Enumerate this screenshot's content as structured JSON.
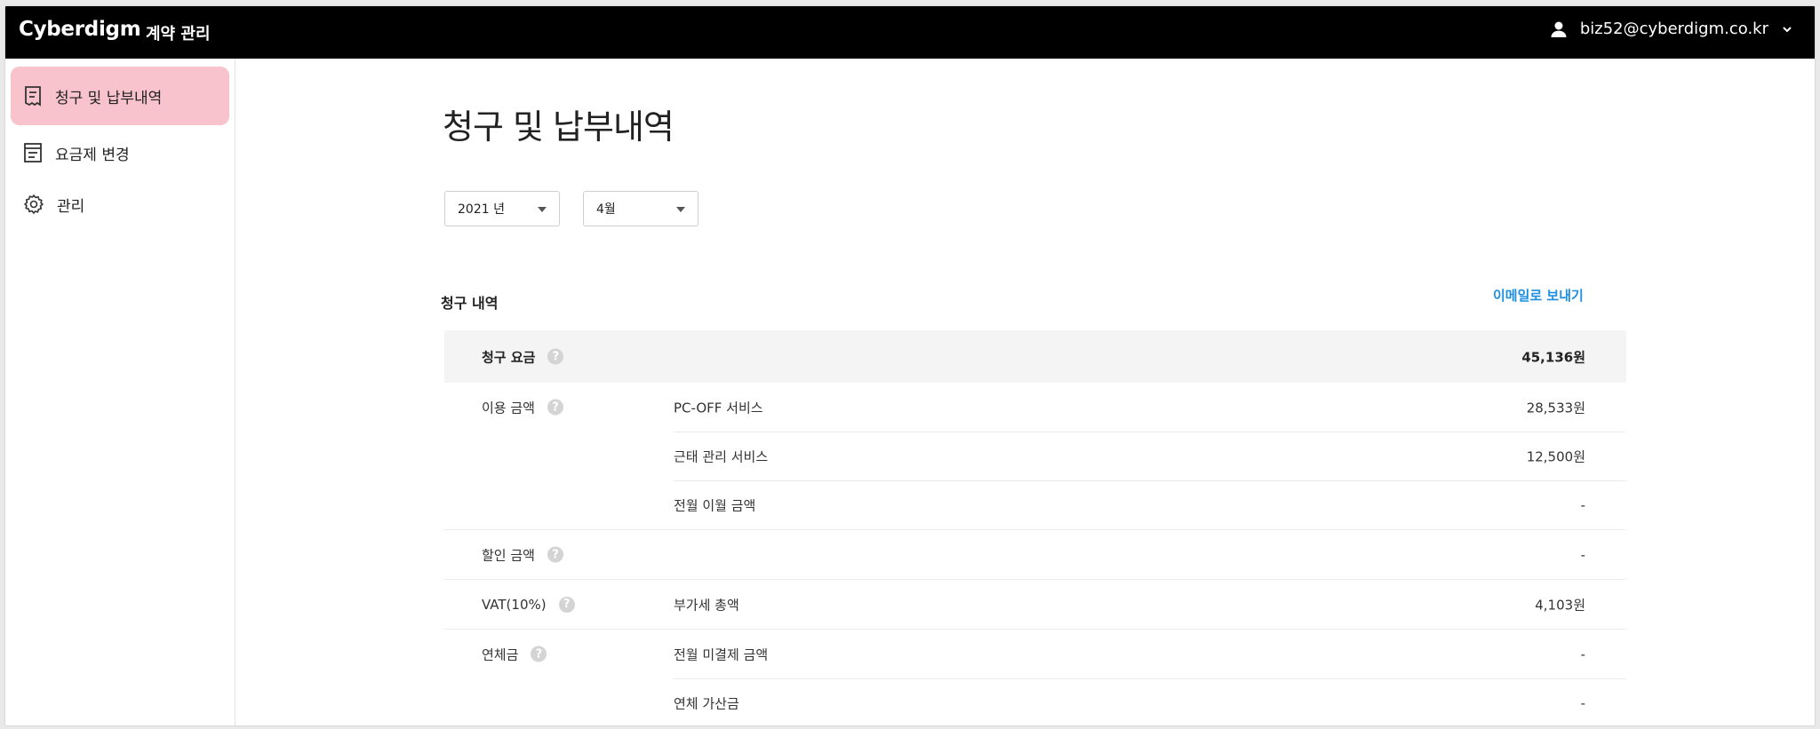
{
  "header": {
    "brand": "Cyberdigm",
    "app_name": "계약 관리",
    "user_email": "biz52@cyberdigm.co.kr",
    "user_icon": "user-icon",
    "menu_icon": "chevron-down-icon"
  },
  "sidebar": {
    "items": [
      {
        "label": "청구 및 납부내역",
        "icon": "receipt-icon",
        "active": true
      },
      {
        "label": "요금제 변경",
        "icon": "list-icon",
        "active": false
      },
      {
        "label": "관리",
        "icon": "gear-icon",
        "active": false
      }
    ]
  },
  "main": {
    "title": "청구 및 납부내역",
    "year_select": "2021 년",
    "month_select": "4월",
    "section_title": "청구 내역",
    "email_link": "이메일로 보내기",
    "rows": {
      "billed": {
        "label": "청구 요금",
        "amount": "45,136원"
      },
      "usage": {
        "label": "이용 금액"
      },
      "pcoff": {
        "item": "PC-OFF 서비스",
        "amount": "28,533원"
      },
      "attendance": {
        "item": "근태 관리 서비스",
        "amount": "12,500원"
      },
      "carryover": {
        "item": "전월 이월 금액",
        "amount": "-"
      },
      "discount": {
        "label": "할인 금액",
        "amount": "-"
      },
      "vat": {
        "label": "VAT(10%)",
        "item": "부가세 총액",
        "amount": "4,103원"
      },
      "late": {
        "label": "연체금",
        "item": "전월 미결제 금액",
        "amount": "-"
      },
      "late_fee": {
        "item": "연체 가산금",
        "amount": "-"
      }
    }
  },
  "colors": {
    "topbar": "#000000",
    "active_nav": "#f8c3cc",
    "link": "#1e8fe0"
  }
}
